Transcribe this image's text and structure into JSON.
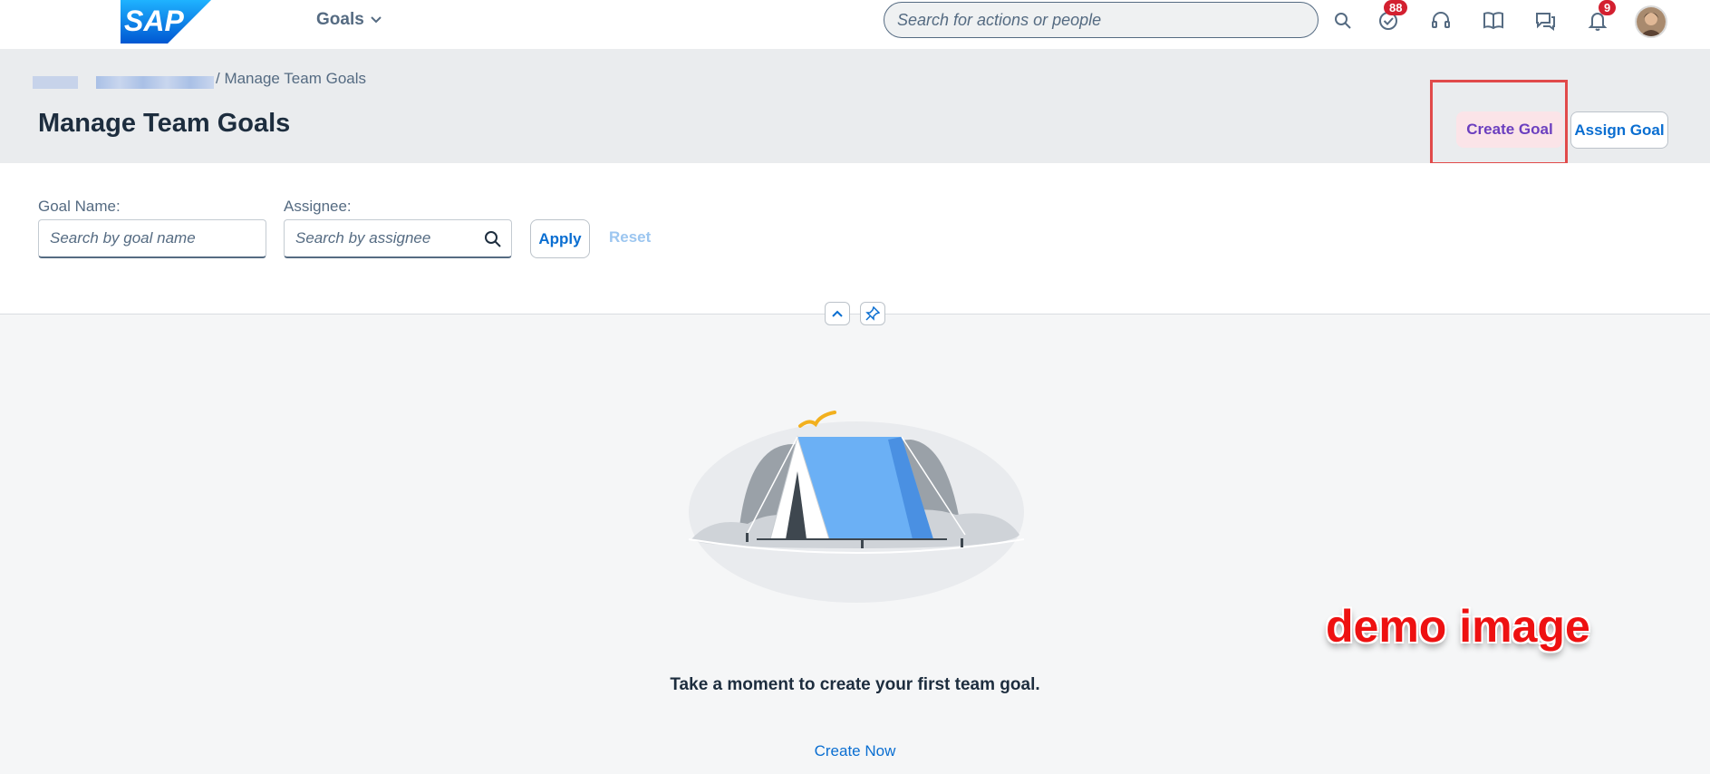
{
  "shell": {
    "logo_text": "SAP",
    "app_title": "Goals",
    "search_placeholder": "Search for actions or people",
    "icons": [
      "search-icon",
      "tasks-icon",
      "headset-icon",
      "learning-icon",
      "feedback-icon",
      "bell-icon"
    ],
    "tasks_badge": "88",
    "notifications_badge": "9"
  },
  "header": {
    "breadcrumb_current": "/ Manage Team Goals",
    "title": "Manage Team Goals",
    "create_goal_label": "Create Goal",
    "assign_goal_label": "Assign Goal"
  },
  "filters": {
    "goal_name_label": "Goal Name:",
    "goal_name_placeholder": "Search by goal name",
    "assignee_label": "Assignee:",
    "assignee_placeholder": "Search by assignee",
    "apply_label": "Apply",
    "reset_label": "Reset"
  },
  "empty_state": {
    "message": "Take a moment to create your first team goal.",
    "link_label": "Create Now"
  },
  "overlay": {
    "watermark": "demo image"
  },
  "colors": {
    "accent": "#0a6ed1",
    "highlight_border": "#e14a4a",
    "badge": "#d32030",
    "tent_blue": "#6bb0f5"
  }
}
